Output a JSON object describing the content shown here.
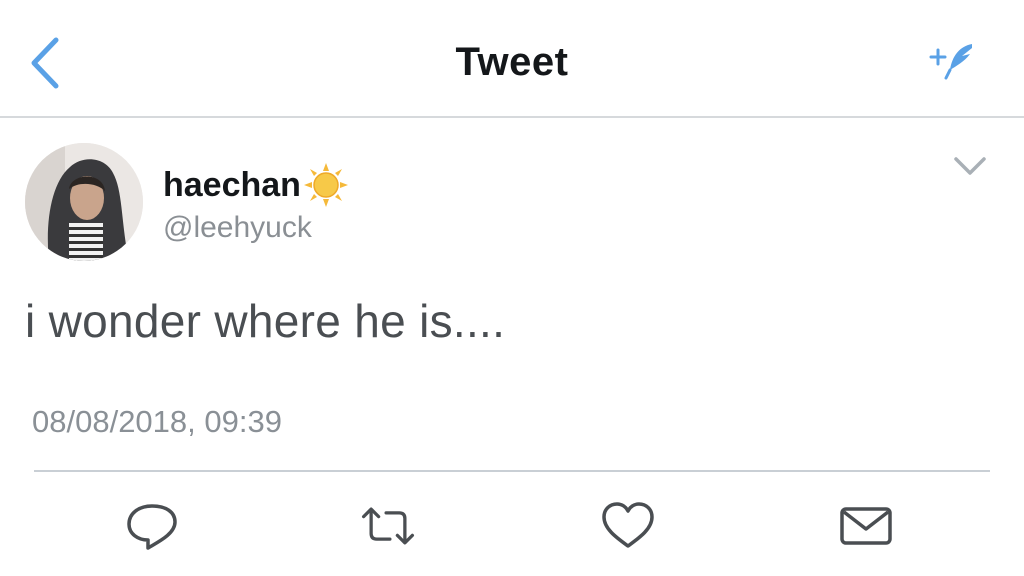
{
  "navbar": {
    "title": "Tweet",
    "back_icon": "chevron-left-icon",
    "compose_icon": "compose-tweet-icon",
    "accent": "#5aa1e6"
  },
  "tweet": {
    "display_name": "haechan",
    "name_emoji": "sun-emoji",
    "handle": "@leehyuck",
    "text": "i wonder where he is....",
    "timestamp": "08/08/2018, 09:39"
  },
  "actions": [
    {
      "name": "reply",
      "icon": "reply-icon"
    },
    {
      "name": "retweet",
      "icon": "retweet-icon"
    },
    {
      "name": "like",
      "icon": "heart-icon"
    },
    {
      "name": "share",
      "icon": "envelope-icon"
    }
  ],
  "colors": {
    "text_primary": "#14171a",
    "text_secondary": "#8a8f94",
    "tweet_text": "#4a4e52",
    "divider": "#c9cfd5",
    "icon_gray": "#657786"
  }
}
